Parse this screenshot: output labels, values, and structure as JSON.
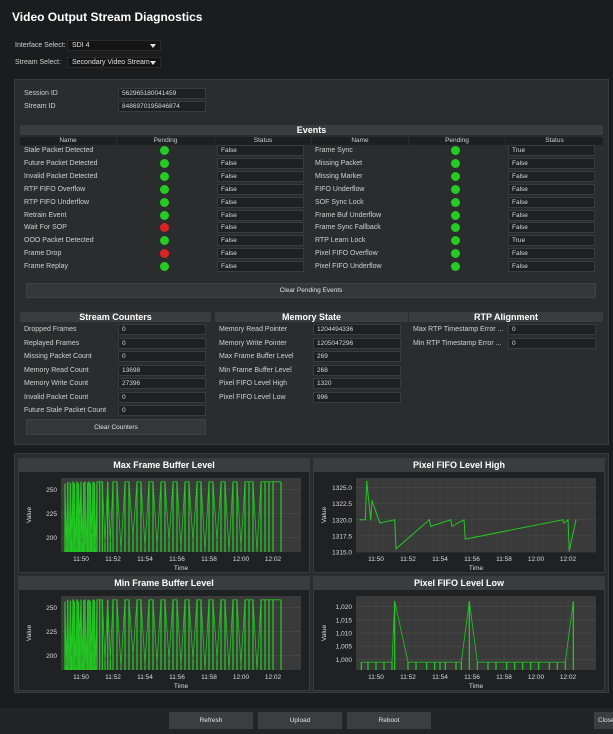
{
  "window": {
    "title": "Video Output Stream Diagnostics"
  },
  "controls": {
    "interface_label": "Interface Select:",
    "interface_value": "SDI 4",
    "stream_label": "Stream Select:",
    "stream_value": "Secondary Video Stream"
  },
  "session": {
    "session_id_label": "Session ID",
    "session_id_value": "562965180041459",
    "stream_id_label": "Stream ID",
    "stream_id_value": "8486970195846874"
  },
  "events": {
    "title": "Events",
    "columns": [
      "Name",
      "Pending",
      "Status",
      "Name",
      "Pending",
      "Status"
    ],
    "left": [
      {
        "name": "Stale Packet Detected",
        "pending": "green",
        "status": "False"
      },
      {
        "name": "Future Packet Detected",
        "pending": "green",
        "status": "False"
      },
      {
        "name": "Invalid Packet Detected",
        "pending": "green",
        "status": "False"
      },
      {
        "name": "RTP FIFO Overflow",
        "pending": "green",
        "status": "False"
      },
      {
        "name": "RTP FIFO Underflow",
        "pending": "green",
        "status": "False"
      },
      {
        "name": "Retrain Event",
        "pending": "green",
        "status": "False"
      },
      {
        "name": "Wait For SOP",
        "pending": "red",
        "status": "False"
      },
      {
        "name": "OOO Packet Detected",
        "pending": "green",
        "status": "False"
      },
      {
        "name": "Frame Drop",
        "pending": "red",
        "status": "False"
      },
      {
        "name": "Frame Replay",
        "pending": "green",
        "status": "False"
      }
    ],
    "right": [
      {
        "name": "Frame Sync",
        "pending": "green",
        "status": "True"
      },
      {
        "name": "Missing Packet",
        "pending": "green",
        "status": "False"
      },
      {
        "name": "Missing Marker",
        "pending": "green",
        "status": "False"
      },
      {
        "name": "FIFO Underflow",
        "pending": "green",
        "status": "False"
      },
      {
        "name": "SOF Sync Lock",
        "pending": "green",
        "status": "False"
      },
      {
        "name": "Frame Buf Underflow",
        "pending": "green",
        "status": "False"
      },
      {
        "name": "Frame Sync Fallback",
        "pending": "green",
        "status": "False"
      },
      {
        "name": "RTP Learn Lock",
        "pending": "green",
        "status": "True"
      },
      {
        "name": "Pixel FIFO Overflow",
        "pending": "green",
        "status": "False"
      },
      {
        "name": "Pixel FIFO Underflow",
        "pending": "green",
        "status": "False"
      }
    ],
    "clear_label": "Clear Pending Events"
  },
  "stream_counters": {
    "title": "Stream Counters",
    "rows": [
      {
        "label": "Dropped Frames",
        "value": "0"
      },
      {
        "label": "Replayed Frames",
        "value": "0"
      },
      {
        "label": "Missing Packet Count",
        "value": "0"
      },
      {
        "label": "Memory Read Count",
        "value": "13698"
      },
      {
        "label": "Memory Write Count",
        "value": "27396"
      },
      {
        "label": "Invalid Packet Count",
        "value": "0"
      },
      {
        "label": "Future Stale Packet Count",
        "value": "0"
      }
    ],
    "clear_label": "Clear Counters"
  },
  "memory_state": {
    "title": "Memory State",
    "rows": [
      {
        "label": "Memory Read Pointer",
        "value": "1204494336"
      },
      {
        "label": "Memory Write Pointer",
        "value": "1205047296"
      },
      {
        "label": "Max Frame Buffer Level",
        "value": "269"
      },
      {
        "label": "Min Frame Buffer Level",
        "value": "268"
      },
      {
        "label": "Pixel FIFO Level High",
        "value": "1320"
      },
      {
        "label": "Pixel FIFO Level Low",
        "value": "996"
      }
    ]
  },
  "rtp_alignment": {
    "title": "RTP Alignment",
    "rows": [
      {
        "label": "Max RTP Timestamp Error ...",
        "value": "0"
      },
      {
        "label": "Min RTP Timestamp Error ...",
        "value": "0"
      }
    ]
  },
  "colors": {
    "ok": "#22cc22",
    "alarm": "#dd2222",
    "series": "#22c922",
    "background": "#1b1c1d",
    "panel": "#2b2c2d"
  },
  "chart_data": [
    {
      "type": "bar",
      "title": "Max Frame Buffer Level",
      "xlabel": "Time",
      "ylabel": "Value",
      "ylim": [
        185,
        262
      ],
      "yticks": [
        "250",
        "225",
        "200"
      ],
      "xticks": [
        "11:50",
        "11:52",
        "11:54",
        "11:56",
        "11:58",
        "12:00",
        "12:02"
      ],
      "x": [
        "11:49:00",
        "11:49:05",
        "11:49:10",
        "11:49:15",
        "11:49:20",
        "11:49:25",
        "11:49:30",
        "11:49:35",
        "11:49:40",
        "11:49:45",
        "11:49:50",
        "11:49:55",
        "11:50:00",
        "11:50:05",
        "11:50:10",
        "11:50:15",
        "11:50:20",
        "11:50:25",
        "11:50:30",
        "11:50:35",
        "11:50:40",
        "11:50:45",
        "11:50:50",
        "11:50:55",
        "11:51:00",
        "11:51:10",
        "11:51:20",
        "11:51:30",
        "11:51:40",
        "11:51:50",
        "11:52:00",
        "11:52:15",
        "11:52:30",
        "11:52:45",
        "11:53:00",
        "11:53:15",
        "11:53:30",
        "11:53:45",
        "11:54:00",
        "11:54:15",
        "11:54:30",
        "11:54:45",
        "11:55:00",
        "11:55:15",
        "11:55:30",
        "11:55:45",
        "11:56:00",
        "11:56:15",
        "11:56:30",
        "11:56:45",
        "11:57:00",
        "11:57:15",
        "11:57:30",
        "11:57:45",
        "11:58:00",
        "11:58:15",
        "11:58:30",
        "11:58:45",
        "11:59:00",
        "11:59:15",
        "11:59:30",
        "11:59:45",
        "12:00:00",
        "12:00:15",
        "12:00:30",
        "12:00:45",
        "12:01:00",
        "12:01:15",
        "12:01:30",
        "12:01:45",
        "12:02:00",
        "12:02:30"
      ],
      "values": [
        256,
        190,
        258,
        188,
        257,
        200,
        258,
        256,
        190,
        258,
        256,
        220,
        258,
        195,
        257,
        258,
        186,
        257,
        258,
        256,
        205,
        258,
        257,
        190,
        258,
        258,
        258,
        195,
        258,
        196,
        258,
        258,
        188,
        258,
        258,
        200,
        258,
        258,
        190,
        258,
        258,
        192,
        258,
        258,
        196,
        258,
        258,
        190,
        258,
        258,
        196,
        258,
        258,
        186,
        258,
        258,
        197,
        258,
        258,
        186,
        258,
        258,
        190,
        258,
        258,
        258,
        185,
        258,
        258,
        258,
        258,
        258
      ]
    },
    {
      "type": "line",
      "title": "Pixel FIFO Level High",
      "xlabel": "Time",
      "ylabel": "Value",
      "ylim": [
        1315,
        1326.5
      ],
      "yticks": [
        "1325.0",
        "1322.5",
        "1320.0",
        "1317.5",
        "1315.0"
      ],
      "xticks": [
        "11:50",
        "11:52",
        "11:54",
        "11:56",
        "11:58",
        "12:00",
        "12:02"
      ],
      "x": [
        "11:49:00",
        "11:49:20",
        "11:49:25",
        "11:49:40",
        "11:49:45",
        "11:50:10",
        "11:50:15",
        "11:51:10",
        "11:51:15",
        "11:53:20",
        "11:53:25",
        "11:54:40",
        "11:54:45",
        "11:55:30",
        "11:55:35",
        "12:01:40",
        "12:01:45",
        "12:02:00",
        "12:02:05",
        "12:02:30"
      ],
      "values": [
        1320.0,
        1320.0,
        1326.0,
        1320.0,
        1323.0,
        1320.0,
        1319.5,
        1320.0,
        1315.5,
        1320.0,
        1319.0,
        1320.0,
        1319.0,
        1320.0,
        1317.0,
        1320.0,
        1319.5,
        1320.0,
        1315.2,
        1320.0
      ]
    },
    {
      "type": "bar",
      "title": "Min Frame Buffer Level",
      "xlabel": "Time",
      "ylabel": "Value",
      "ylim": [
        185,
        262
      ],
      "yticks": [
        "250",
        "225",
        "200"
      ],
      "xticks": [
        "11:50",
        "11:52",
        "11:54",
        "11:56",
        "11:58",
        "12:00",
        "12:02"
      ],
      "x": [
        "11:49:00",
        "11:49:05",
        "11:49:10",
        "11:49:15",
        "11:49:20",
        "11:49:25",
        "11:49:30",
        "11:49:35",
        "11:49:40",
        "11:49:45",
        "11:49:50",
        "11:49:55",
        "11:50:00",
        "11:50:05",
        "11:50:10",
        "11:50:15",
        "11:50:20",
        "11:50:25",
        "11:50:30",
        "11:50:35",
        "11:50:40",
        "11:50:45",
        "11:50:50",
        "11:50:55",
        "11:51:00",
        "11:51:10",
        "11:51:20",
        "11:51:30",
        "11:51:40",
        "11:51:50",
        "11:52:00",
        "11:52:15",
        "11:52:30",
        "11:52:45",
        "11:53:00",
        "11:53:15",
        "11:53:30",
        "11:53:45",
        "11:54:00",
        "11:54:15",
        "11:54:30",
        "11:54:45",
        "11:55:00",
        "11:55:15",
        "11:55:30",
        "11:55:45",
        "11:56:00",
        "11:56:15",
        "11:56:30",
        "11:56:45",
        "11:57:00",
        "11:57:15",
        "11:57:30",
        "11:57:45",
        "11:58:00",
        "11:58:15",
        "11:58:30",
        "11:58:45",
        "11:59:00",
        "11:59:15",
        "11:59:30",
        "11:59:45",
        "12:00:00",
        "12:00:15",
        "12:00:30",
        "12:00:45",
        "12:01:00",
        "12:01:15",
        "12:01:30",
        "12:01:45",
        "12:02:00",
        "12:02:30"
      ],
      "values": [
        256,
        190,
        258,
        188,
        257,
        200,
        258,
        256,
        190,
        258,
        256,
        220,
        258,
        195,
        257,
        258,
        186,
        257,
        258,
        256,
        205,
        258,
        257,
        190,
        258,
        258,
        258,
        195,
        258,
        196,
        258,
        258,
        188,
        258,
        258,
        200,
        258,
        258,
        190,
        258,
        258,
        192,
        258,
        258,
        196,
        258,
        258,
        190,
        258,
        258,
        196,
        258,
        258,
        186,
        258,
        258,
        197,
        258,
        258,
        186,
        258,
        258,
        190,
        258,
        258,
        258,
        185,
        258,
        258,
        258,
        258,
        258
      ]
    },
    {
      "type": "bar",
      "title": "Pixel FIFO Level Low",
      "xlabel": "Time",
      "ylabel": "Value",
      "ylim": [
        996,
        1024
      ],
      "yticks": [
        "1,020",
        "1,015",
        "1,010",
        "1,005",
        "1,000"
      ],
      "xticks": [
        "11:50",
        "11:52",
        "11:54",
        "11:56",
        "11:58",
        "12:00",
        "12:02"
      ],
      "x": [
        "11:49:05",
        "11:49:30",
        "11:50:00",
        "11:50:30",
        "11:51:00",
        "11:51:10",
        "11:52:00",
        "11:52:30",
        "11:53:10",
        "11:53:40",
        "11:54:00",
        "11:54:20",
        "11:55:00",
        "11:55:20",
        "11:55:50",
        "11:56:20",
        "11:57:00",
        "11:57:30",
        "11:58:10",
        "11:58:40",
        "11:59:10",
        "11:59:40",
        "12:00:10",
        "12:00:50",
        "12:01:20",
        "12:01:50",
        "12:02:20"
      ],
      "values": [
        999,
        999,
        999,
        999,
        999,
        1022,
        999,
        999,
        999,
        999,
        999,
        999,
        999,
        999,
        1022,
        999,
        999,
        999,
        999,
        999,
        999,
        999,
        999,
        999,
        999,
        999,
        1022
      ]
    }
  ],
  "footer": {
    "refresh_label": "Refresh",
    "upload_label": "Upload",
    "reboot_label": "Reboot",
    "close_label": "Close"
  }
}
